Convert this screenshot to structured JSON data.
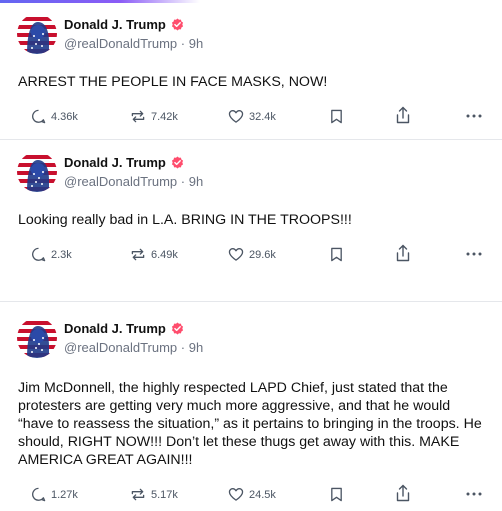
{
  "colors": {
    "accent": "#8b5cf6",
    "badge": "#ff4d6d",
    "text": "#111111",
    "muted": "#6b7280"
  },
  "posts": [
    {
      "author": "Donald J. Trump",
      "handle": "@realDonaldTrump",
      "time": "9h",
      "separator": "·",
      "text": "ARREST THE PEOPLE IN FACE MASKS, NOW!",
      "replies": "4.36k",
      "reposts": "7.42k",
      "likes": "32.4k"
    },
    {
      "author": "Donald J. Trump",
      "handle": "@realDonaldTrump",
      "time": "9h",
      "separator": "·",
      "text": "Looking really bad in L.A. BRING IN THE TROOPS!!!",
      "replies": "2.3k",
      "reposts": "6.49k",
      "likes": "29.6k"
    },
    {
      "author": "Donald J. Trump",
      "handle": "@realDonaldTrump",
      "time": "9h",
      "separator": "·",
      "text": "Jim McDonnell, the highly respected LAPD Chief, just stated that the protesters are getting very much more aggressive, and that he would “have to reassess the situation,” as it pertains to bringing in the troops. He should, RIGHT NOW!!! Don’t let these thugs get away with this. MAKE AMERICA GREAT AGAIN!!!",
      "replies": "1.27k",
      "reposts": "5.17k",
      "likes": "24.5k"
    }
  ]
}
